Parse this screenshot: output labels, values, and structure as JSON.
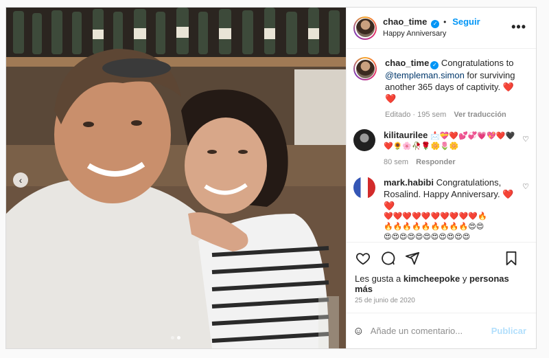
{
  "post": {
    "username": "chao_time",
    "follow_label": "Seguir",
    "separator": "•",
    "subtitle": "Happy Anniversary",
    "more_label": "•••"
  },
  "caption": {
    "username": "chao_time",
    "text_before": " Congratulations to ",
    "mention": "@templeman.simon",
    "text_after": " for surviving another 365 days of captivity. ❤️❤️",
    "edited": "Editado · 195 sem",
    "translate": "Ver traducción"
  },
  "comments": [
    {
      "username": "kilitaurilee",
      "line1": "📩💝❤️💕💞💗💖❤️🖤",
      "line2": "❤️🌻🌸🥀🌹🌼🌷🌼",
      "time": "80 sem",
      "reply": "Responder"
    },
    {
      "username": "mark.habibi",
      "text": " Congratulations, Rosalind. Happy Anniversary. ❤️❤️",
      "emoji_rows": [
        "❤️❤️❤️❤️❤️❤️❤️❤️❤️❤️🔥",
        "🔥🔥🔥🔥🔥🔥🔥🔥🔥😍😍",
        "😍😍😍😍😍😍😍😍😍😍😍",
        "😊😊😊😊😊😊😊😊😊😊😊",
        "😊😊😊😊😊😊😊😊😊😊😊",
        "😊😊😊😊😊😊😊😊😊😊😊",
        "💋💋💋💋💋💋💋💋💋💋💋",
        "❤️❤️❤️❤️❤️❤️❤️❤️❤️❤️❤️",
        "💋💋💋💋💋💋💋💋💋💋💋"
      ]
    }
  ],
  "likes": {
    "prefix": "Les gusta a ",
    "user": "kimcheepoke",
    "middle": " y ",
    "others": "personas más"
  },
  "date": "25 de junio de 2020",
  "composer": {
    "placeholder": "Añade un comentario...",
    "publish": "Publicar"
  },
  "carousel": {
    "prev_icon": "‹",
    "slide_count": 2,
    "active_slide": 2
  },
  "colors": {
    "accent": "#0095f6",
    "link": "#00376b",
    "muted": "#8e8e8e",
    "publish_disabled": "#b2dffc"
  }
}
